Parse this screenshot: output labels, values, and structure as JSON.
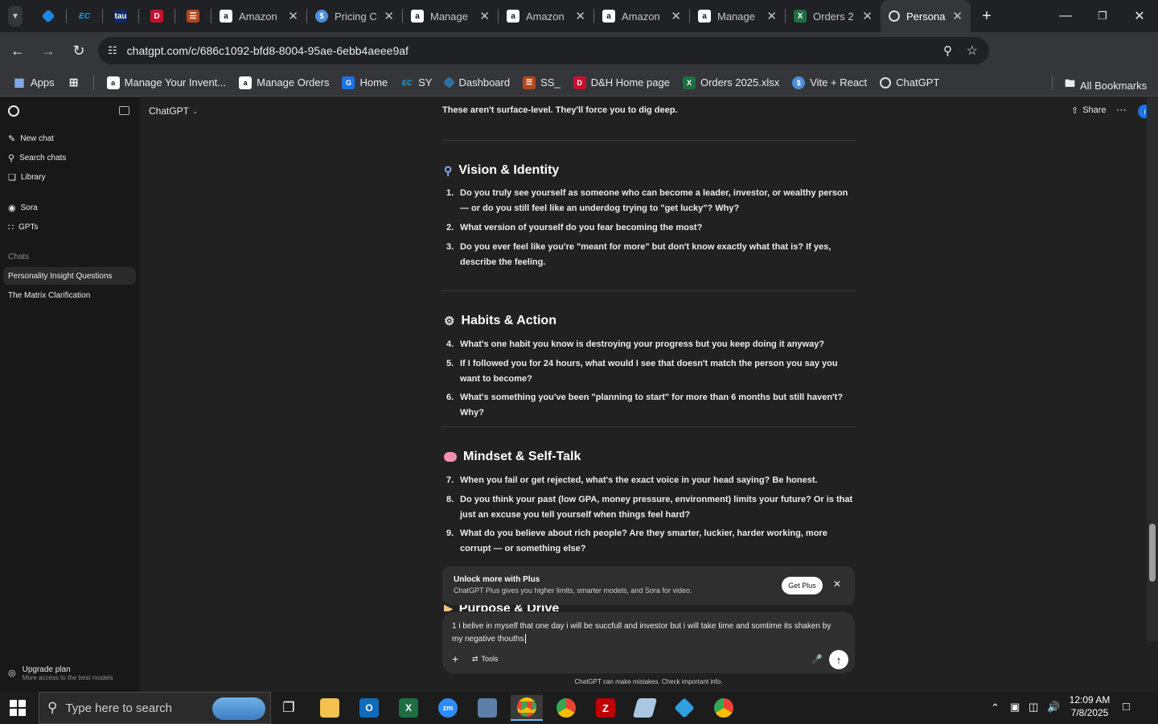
{
  "browser": {
    "tabs": [
      {
        "title": "",
        "icon": "blue-diamond-icon"
      },
      {
        "title": "",
        "icon": "ec-icon"
      },
      {
        "title": "",
        "icon": "tau-icon"
      },
      {
        "title": "",
        "icon": "dh-icon"
      },
      {
        "title": "",
        "icon": "stack-icon"
      },
      {
        "title": "Amazon",
        "icon": "amazon-icon"
      },
      {
        "title": "Pricing C",
        "icon": "dollar-icon"
      },
      {
        "title": "Manage",
        "icon": "amazon-icon"
      },
      {
        "title": "Amazon",
        "icon": "amazon-icon"
      },
      {
        "title": "Amazon",
        "icon": "amazon-icon"
      },
      {
        "title": "Manage",
        "icon": "amazon-icon"
      },
      {
        "title": "Orders 2",
        "icon": "excel-icon"
      },
      {
        "title": "Personal",
        "icon": "chatgpt-icon"
      }
    ],
    "url": "chatgpt.com/c/686c1092-bfd8-8004-95ae-6ebb4aeee9af",
    "bookmarks": [
      {
        "label": "Apps"
      },
      {
        "label": ""
      },
      {
        "label": "Manage Your Invent..."
      },
      {
        "label": "Manage Orders"
      },
      {
        "label": "Home"
      },
      {
        "label": "SY"
      },
      {
        "label": "Dashboard"
      },
      {
        "label": "SS_"
      },
      {
        "label": "D&H Home page"
      },
      {
        "label": "Orders 2025.xlsx"
      },
      {
        "label": "Vite + React"
      },
      {
        "label": "ChatGPT"
      }
    ],
    "all_bookmarks": "All Bookmarks"
  },
  "sidebar": {
    "new_chat": "New chat",
    "search": "Search chats",
    "library": "Library",
    "sora": "Sora",
    "gpts": "GPTs",
    "chats_heading": "Chats",
    "chats": [
      "Personality Insight Questions",
      "The Matrix Clarification"
    ],
    "upgrade_title": "Upgrade plan",
    "upgrade_sub": "More access to the best models"
  },
  "header": {
    "model": "ChatGPT",
    "share": "Share"
  },
  "content": {
    "intro": "These aren't surface-level. They'll force you to dig deep.",
    "sections": [
      {
        "title": "Vision & Identity",
        "icon": "magnifier-icon",
        "questions": [
          {
            "n": "1.",
            "text": "Do you truly see yourself as someone who can become a leader, investor, or wealthy person — or do you still feel like an underdog trying to \"get lucky\"? Why?"
          },
          {
            "n": "2.",
            "text": "What version of yourself do you fear becoming the most?"
          },
          {
            "n": "3.",
            "text": "Do you ever feel like you're \"meant for more\" but don't know exactly what that is? If yes, describe the feeling."
          }
        ]
      },
      {
        "title": "Habits & Action",
        "icon": "gear-icon",
        "questions": [
          {
            "n": "4.",
            "text": "What's one habit you know is destroying your progress but you keep doing it anyway?"
          },
          {
            "n": "5.",
            "text": "If I followed you for 24 hours, what would I see that doesn't match the person you say you want to become?"
          },
          {
            "n": "6.",
            "text": "What's something you've been \"planning to start\" for more than 6 months but still haven't? Why?"
          }
        ]
      },
      {
        "title": "Mindset & Self-Talk",
        "icon": "brain-icon",
        "questions": [
          {
            "n": "7.",
            "text": "When you fail or get rejected, what's the exact voice in your head saying? Be honest."
          },
          {
            "n": "8.",
            "text": "Do you think your past (low GPA, money pressure, environment) limits your future? Or is that just an excuse you tell yourself when things feel hard?"
          },
          {
            "n": "9.",
            "text": "What do you believe about rich people? Are they smarter, luckier, harder working, more corrupt — or something else?"
          }
        ]
      }
    ],
    "next_section_partial": "Purpose & Drive"
  },
  "upsell": {
    "title": "Unlock more with Plus",
    "body": "ChatGPT Plus gives you higher limits, smarter models, and Sora for video.",
    "button": "Get Plus"
  },
  "composer": {
    "text": "1 i belive in myself that one day i will be succfull  and investor  but i will take time and somtime its shaken by my negative thouths",
    "tools": "Tools",
    "disclaimer": "ChatGPT can make mistakes. Check important info."
  },
  "taskbar": {
    "search_placeholder": "Type here to search",
    "time": "12:09 AM",
    "date": "7/8/2025"
  },
  "colors": {
    "accent_blue": "#1a73e8",
    "plus_button": "#ffffff",
    "taskbar": "#1c1c1c"
  }
}
